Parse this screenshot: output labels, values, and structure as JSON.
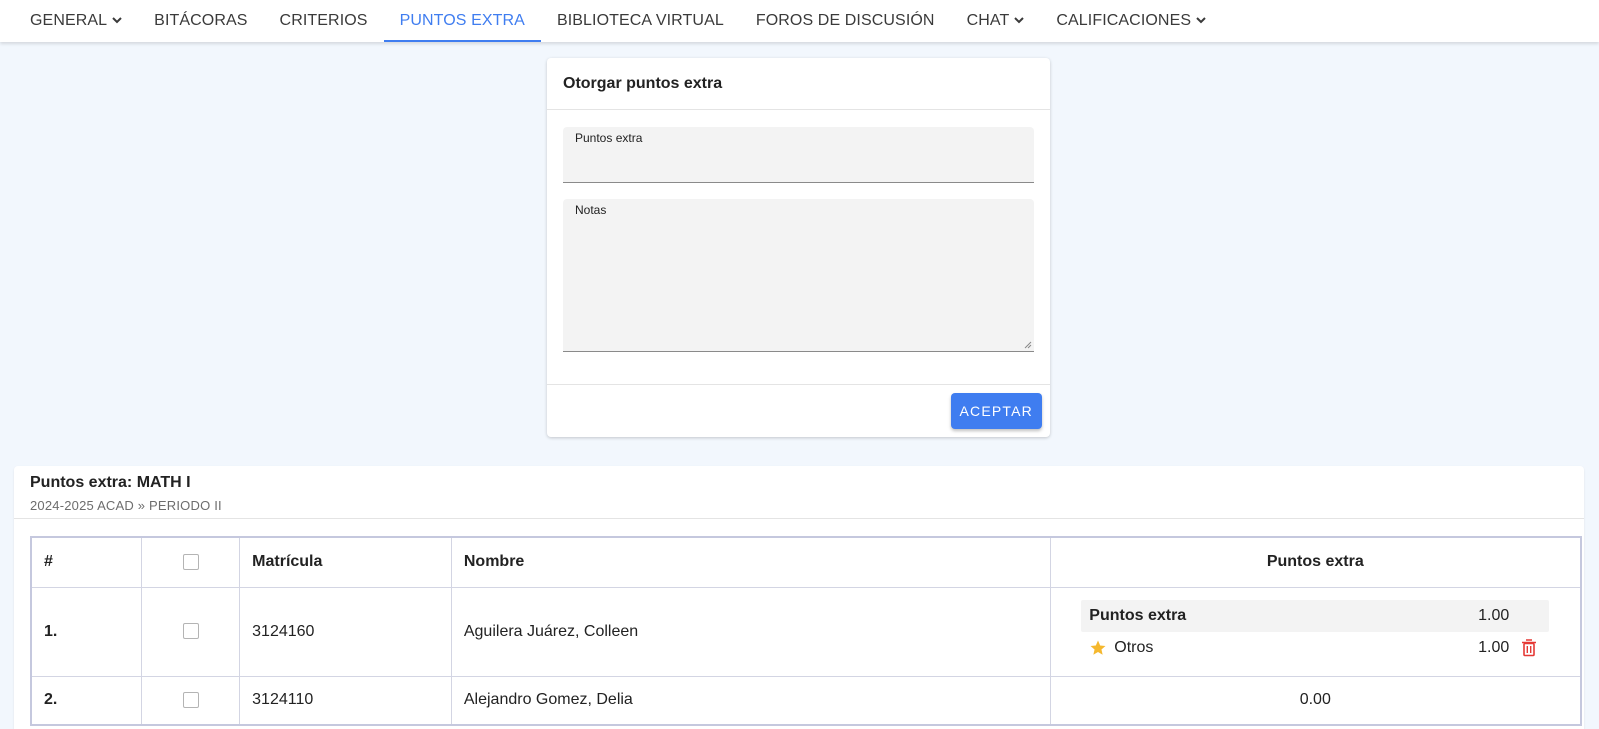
{
  "nav": {
    "items": [
      {
        "label": "GENERAL",
        "dropdown": true
      },
      {
        "label": "BITÁCORAS",
        "dropdown": false
      },
      {
        "label": "CRITERIOS",
        "dropdown": false
      },
      {
        "label": "PUNTOS EXTRA",
        "dropdown": false,
        "active": true
      },
      {
        "label": "BIBLIOTECA VIRTUAL",
        "dropdown": false
      },
      {
        "label": "FOROS DE DISCUSIÓN",
        "dropdown": false
      },
      {
        "label": "CHAT",
        "dropdown": true
      },
      {
        "label": "CALIFICACIONES",
        "dropdown": true
      }
    ]
  },
  "form": {
    "title": "Otorgar puntos extra",
    "points_label": "Puntos extra",
    "points_value": "",
    "notes_label": "Notas",
    "notes_value": "",
    "accept_label": "ACEPTAR"
  },
  "table": {
    "title": "Puntos extra: MATH I",
    "subtitle": "2024-2025 ACAD » PERIODO II",
    "headers": {
      "num": "#",
      "matricula": "Matrícula",
      "nombre": "Nombre",
      "puntos": "Puntos extra"
    },
    "rows": [
      {
        "num": "1.",
        "matricula": "3124160",
        "nombre": "Aguilera Juárez, Colleen",
        "summary_label": "Puntos extra",
        "summary_value": "1.00",
        "detail_name": "Otros",
        "detail_value": "1.00",
        "detail_icon": "star-icon"
      },
      {
        "num": "2.",
        "matricula": "3124110",
        "nombre": "Alejandro Gomez, Delia",
        "total": "0.00"
      }
    ]
  },
  "colors": {
    "accent": "#3f7df0",
    "star": "#f5b82e",
    "delete": "#e53935",
    "background": "#f2f7fd"
  }
}
